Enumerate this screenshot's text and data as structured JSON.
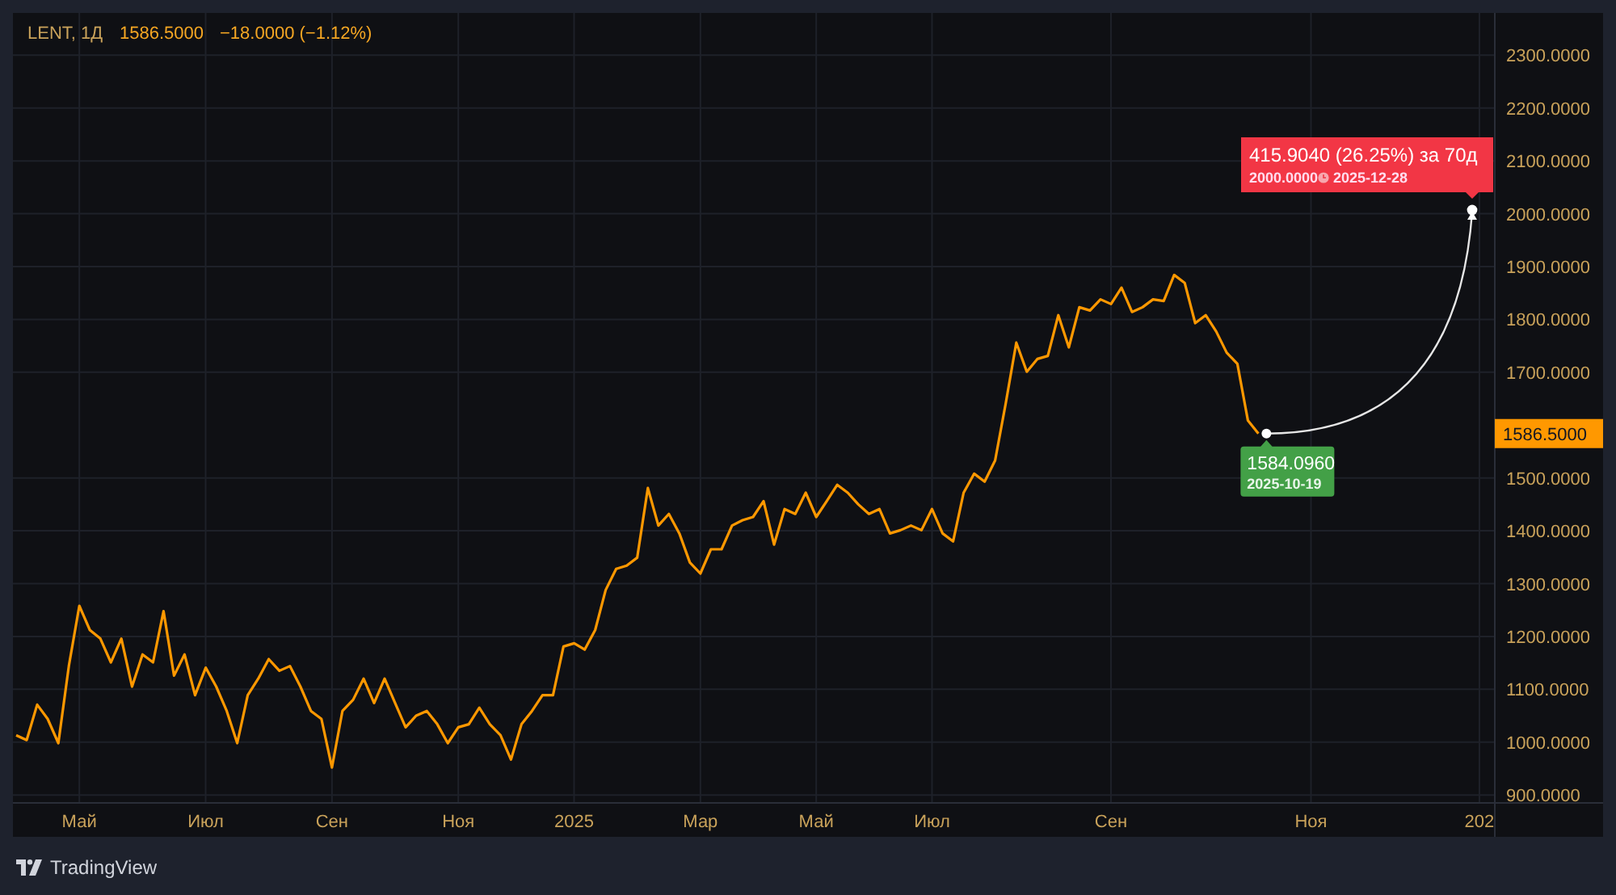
{
  "header": {
    "symbol": "LENT, 1Д",
    "price": "1586.5000",
    "change": "−18.0000 (−1.12%)"
  },
  "chart": {
    "chart_data": {
      "type": "line",
      "categories": [
        null,
        null,
        null,
        null,
        null,
        null,
        "Май",
        null,
        null,
        null,
        null,
        null,
        null,
        null,
        null,
        null,
        null,
        null,
        "Июл",
        null,
        null,
        null,
        null,
        null,
        null,
        null,
        null,
        null,
        null,
        null,
        "Сен",
        null,
        null,
        null,
        null,
        null,
        null,
        null,
        null,
        null,
        null,
        null,
        "Ноя",
        null,
        null,
        null,
        null,
        null,
        null,
        null,
        null,
        null,
        null,
        "2025",
        null,
        null,
        null,
        null,
        null,
        null,
        null,
        null,
        null,
        null,
        null,
        "Мар",
        null,
        null,
        null,
        null,
        null,
        null,
        null,
        null,
        null,
        null,
        "Май",
        null,
        null,
        null,
        null,
        null,
        null,
        null,
        null,
        null,
        null,
        "Июл",
        null,
        null,
        null,
        null,
        null,
        null,
        null,
        null,
        null,
        null,
        null,
        null,
        null,
        null,
        null,
        null,
        "Сен",
        null,
        null,
        null,
        null,
        null,
        null,
        null,
        null,
        null,
        null,
        null,
        null,
        null,
        null,
        null,
        null,
        null,
        null,
        "Ноя",
        null,
        null,
        null,
        null,
        null,
        null,
        null,
        null,
        null,
        null,
        null,
        null,
        null,
        null,
        null,
        "202",
        null
      ],
      "series": [
        {
          "color": "#ff9800",
          "values": [
            1013,
            1004,
            1071,
            1044,
            998,
            1144,
            1258,
            1212,
            1196,
            1151,
            1196,
            1105,
            1166,
            1151,
            1248,
            1126,
            1166,
            1089,
            1141,
            1105,
            1059,
            998,
            1089,
            1120,
            1157,
            1135,
            1144,
            1105,
            1059,
            1044,
            952,
            1059,
            1080,
            1120,
            1074,
            1120,
            1074,
            1028,
            1050,
            1059,
            1034,
            998,
            1028,
            1034,
            1065,
            1034,
            1013,
            967,
            1034,
            1059,
            1089,
            1089,
            1181,
            1187,
            1175,
            1212,
            1288,
            1328,
            1334,
            1349,
            1481,
            1410,
            1432,
            1395,
            1340,
            1319,
            1365,
            1365,
            1410,
            1420,
            1426,
            1456,
            1374,
            1441,
            1432,
            1472,
            1426,
            1456,
            1487,
            1472,
            1450,
            1432,
            1441,
            1395,
            1401,
            1410,
            1401,
            1441,
            1395,
            1380,
            1472,
            1508,
            1493,
            1533,
            1640,
            1756,
            1701,
            1725,
            1731,
            1808,
            1747,
            1823,
            1817,
            1838,
            1829,
            1860,
            1814,
            1823,
            1838,
            1835,
            1884,
            1869,
            1793,
            1808,
            1777,
            1737,
            1716,
            1609,
            1584,
            null,
            null,
            null,
            null,
            null,
            null,
            null,
            null,
            null,
            null,
            null,
            null,
            null,
            null,
            null,
            null,
            null,
            null,
            null,
            null,
            null,
            null
          ]
        }
      ],
      "ylim": [
        885,
        2380
      ],
      "grid": true,
      "yticks": [
        {
          "value": 2300,
          "label": "2300.0000"
        },
        {
          "value": 2200,
          "label": "2200.0000"
        },
        {
          "value": 2100,
          "label": "2100.0000"
        },
        {
          "value": 2000,
          "label": "2000.0000"
        },
        {
          "value": 1900,
          "label": "1900.0000"
        },
        {
          "value": 1800,
          "label": "1800.0000"
        },
        {
          "value": 1700,
          "label": "1700.0000"
        },
        {
          "value": 1500,
          "label": "1500.0000"
        },
        {
          "value": 1400,
          "label": "1400.0000"
        },
        {
          "value": 1300,
          "label": "1300.0000"
        },
        {
          "value": 1200,
          "label": "1200.0000"
        },
        {
          "value": 1100,
          "label": "1100.0000"
        },
        {
          "value": 1000,
          "label": "1000.0000"
        },
        {
          "value": 900,
          "label": "900.0000"
        }
      ]
    },
    "price_tag": "1586.5000",
    "projection": {
      "start_label": "1584.0960",
      "start_date": "2025-10-19",
      "label": "415.9040 (26.25%) за 70д",
      "target_value": "2000.0000",
      "target_date": "2025-12-28"
    }
  },
  "footer": {
    "brand": "TradingView"
  }
}
